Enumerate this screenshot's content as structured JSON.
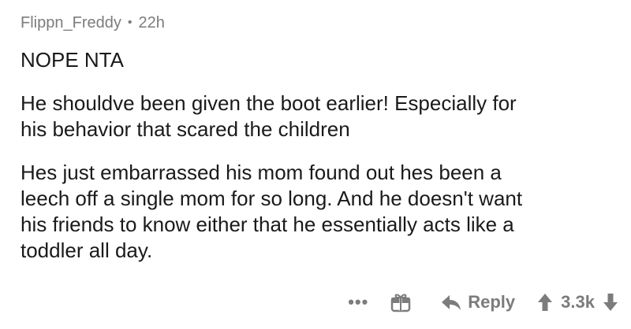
{
  "comment": {
    "author": "Flippn_Freddy",
    "separator": "•",
    "age": "22h",
    "paragraphs": [
      "NOPE NTA",
      "He shouldve been given the boot earlier! Especially for\nhis behavior that scared the children",
      "Hes just embarrassed his mom found out hes been a\nleech off a single mom for so long. And he doesn't want\nhis friends to know either  that he essentially acts like a\ntoddler all day."
    ]
  },
  "actions": {
    "more_label": "•••",
    "gift_icon": "gift-icon",
    "reply_label": "Reply",
    "score": "3.3k"
  },
  "colors": {
    "text": "#1a1a1b",
    "meta": "#7c7c7c"
  }
}
